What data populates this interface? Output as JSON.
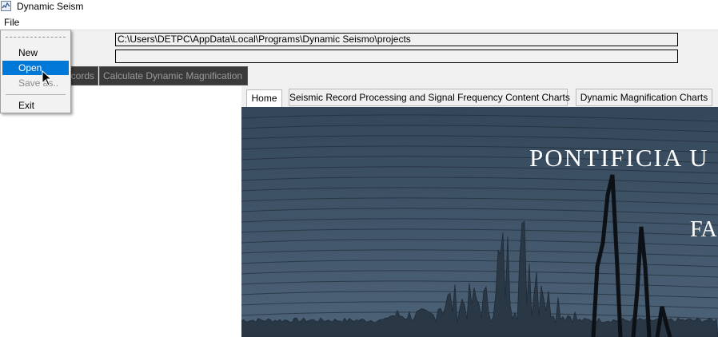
{
  "window": {
    "title": "Dynamic Seism",
    "icon": "app-chart-icon"
  },
  "menubar": {
    "file_label": "File"
  },
  "file_menu": {
    "items": [
      {
        "label": "New",
        "state": "normal"
      },
      {
        "label": "Open",
        "state": "highlighted"
      },
      {
        "label": "Save as..",
        "state": "disabled"
      },
      {
        "label": "Exit",
        "state": "normal"
      }
    ]
  },
  "paths": {
    "project_path": "C:\\Users\\DETPC\\AppData\\Local\\Programs\\Dynamic Seismo\\projects",
    "second_path": ""
  },
  "toolbar": {
    "records_label": "cords",
    "dyn_mag_label": "Calculate Dynamic Magnification"
  },
  "tabs": [
    {
      "label": "Home",
      "active": true
    },
    {
      "label": "Seismic Record Processing and Signal Frequency Content Charts",
      "active": false
    },
    {
      "label": "Dynamic Magnification Charts",
      "active": false
    }
  ],
  "banner": {
    "title": "PONTIFICIA U",
    "subtitle": "FA"
  },
  "colors": {
    "menu_highlight": "#0078d7",
    "toolbar_button": "#3a3a3a",
    "banner_bg": "#3d5166"
  }
}
